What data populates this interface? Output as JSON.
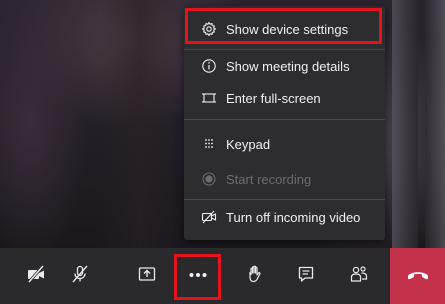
{
  "menu": {
    "items": [
      {
        "label": "Show device settings",
        "icon": "gear-icon",
        "enabled": true
      },
      {
        "label": "Show meeting details",
        "icon": "info-icon",
        "enabled": true
      },
      {
        "label": "Enter full-screen",
        "icon": "fullscreen-icon",
        "enabled": true
      },
      {
        "label": "Keypad",
        "icon": "keypad-icon",
        "enabled": true
      },
      {
        "label": "Start recording",
        "icon": "record-icon",
        "enabled": false
      },
      {
        "label": "Turn off incoming video",
        "icon": "video-off-icon",
        "enabled": true
      }
    ]
  },
  "callbar": {
    "buttons": [
      {
        "name": "camera-off",
        "icon": "camera-off-icon"
      },
      {
        "name": "mute",
        "icon": "mic-off-icon"
      },
      {
        "name": "share",
        "icon": "share-screen-icon"
      },
      {
        "name": "more-actions",
        "icon": "more-icon"
      },
      {
        "name": "raise-hand",
        "icon": "hand-icon"
      },
      {
        "name": "chat",
        "icon": "chat-icon"
      },
      {
        "name": "participants",
        "icon": "people-icon"
      },
      {
        "name": "hang-up",
        "icon": "phone-hangup-icon"
      }
    ]
  },
  "colors": {
    "menu_bg": "#2d2c2e",
    "callbar_bg": "#2a292b",
    "hangup": "#c4314b",
    "highlight": "#e5131c",
    "disabled_text": "#6c6b6e"
  }
}
